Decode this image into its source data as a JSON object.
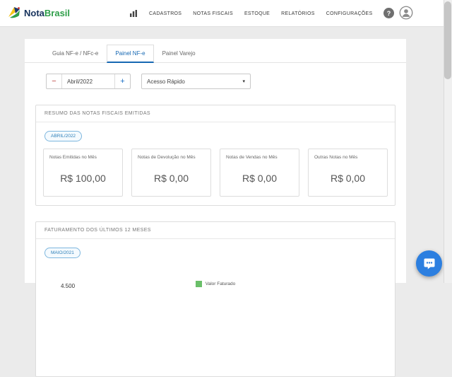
{
  "header": {
    "logo_nota": "Nota",
    "logo_brasil": "Brasil",
    "menu": [
      {
        "label": "CADASTROS"
      },
      {
        "label": "NOTAS FISCAIS"
      },
      {
        "label": "ESTOQUE"
      },
      {
        "label": "RELATÓRIOS"
      },
      {
        "label": "CONFIGURAÇÕES"
      }
    ],
    "help_label": "?"
  },
  "tabs": [
    {
      "label": "Guia NF-e / NFc-e"
    },
    {
      "label": "Painel NF-e"
    },
    {
      "label": "Painel Varejo"
    }
  ],
  "controls": {
    "stepper": {
      "minus": "−",
      "value": "Abril/2022",
      "plus": "+"
    },
    "quick_access": "Acesso Rápido",
    "caret": "▾"
  },
  "summary": {
    "title": "RESUMO DAS NOTAS FISCAIS EMITIDAS",
    "badge": "ABRIL/2022",
    "cards": [
      {
        "label": "Notas Emitidas no Mês",
        "value": "R$ 100,00"
      },
      {
        "label": "Notas de Devolução no Mês",
        "value": "R$ 0,00"
      },
      {
        "label": "Notas de Vendas no Mês",
        "value": "R$ 0,00"
      },
      {
        "label": "Outras Notas no Mês",
        "value": "R$ 0,00"
      }
    ]
  },
  "billing": {
    "title": "FATURAMENTO DOS ÚLTIMOS 12 MESES",
    "badge": "MAIO/2021",
    "legend_label": "Valor Faturado",
    "axis_tick_partial": "4.500"
  },
  "colors": {
    "accent_blue": "#1668b3",
    "badge_blue": "#2d7fb8",
    "legend_green": "#6abf69",
    "chat_blue": "#2c7fe0",
    "logo_navy": "#16325c",
    "logo_green": "#2e9e49"
  }
}
